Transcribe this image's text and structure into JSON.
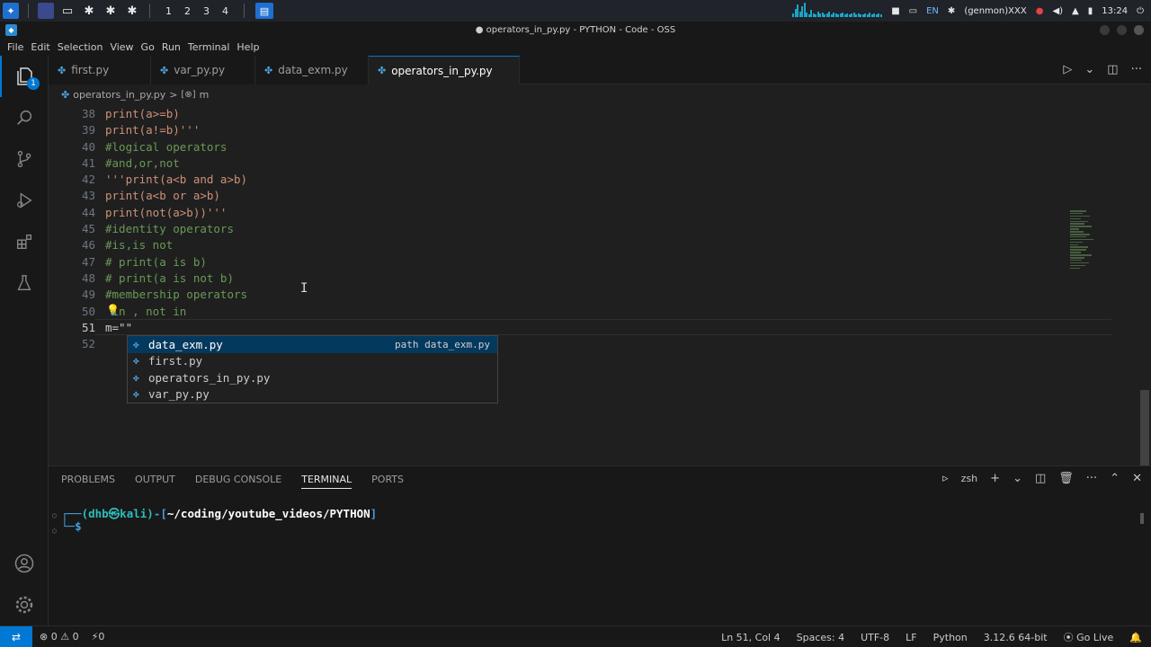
{
  "taskbar": {
    "workspaces": [
      "1",
      "2",
      "3",
      "4"
    ],
    "lang": "EN",
    "user": "(genmon)XXX",
    "time": "13:24"
  },
  "window": {
    "title": "● operators_in_py.py - PYTHON - Code - OSS"
  },
  "menu": [
    "File",
    "Edit",
    "Selection",
    "View",
    "Go",
    "Run",
    "Terminal",
    "Help"
  ],
  "activity": {
    "explorer_badge": "1"
  },
  "tabs": [
    {
      "label": "first.py"
    },
    {
      "label": "var_py.py"
    },
    {
      "label": "data_exm.py"
    },
    {
      "label": "operators_in_py.py"
    }
  ],
  "breadcrumb": {
    "file": "operators_in_py.py",
    "sep": ">",
    "symbol": "m"
  },
  "editor": {
    "lines": [
      {
        "n": "38",
        "text": "print(a>=b)",
        "kind": "str"
      },
      {
        "n": "39",
        "text": "print(a!=b)'''",
        "kind": "str"
      },
      {
        "n": "40",
        "text": "#logical operators",
        "kind": "comment"
      },
      {
        "n": "41",
        "text": "#and,or,not",
        "kind": "comment"
      },
      {
        "n": "42",
        "text": "'''print(a<b and a>b)",
        "kind": "str"
      },
      {
        "n": "43",
        "text": "print(a<b or a>b)",
        "kind": "str"
      },
      {
        "n": "44",
        "text": "print(not(a>b))'''",
        "kind": "str"
      },
      {
        "n": "45",
        "text": "#identity operators",
        "kind": "comment"
      },
      {
        "n": "46",
        "text": "#is,is not",
        "kind": "comment"
      },
      {
        "n": "47",
        "text": "# print(a is b)",
        "kind": "comment"
      },
      {
        "n": "48",
        "text": "# print(a is not b)",
        "kind": "comment"
      },
      {
        "n": "49",
        "text": "#membership operators",
        "kind": "comment"
      },
      {
        "n": "50",
        "text": " in , not in",
        "kind": "comment"
      },
      {
        "n": "51",
        "text": "m=\"\"",
        "kind": "plain"
      },
      {
        "n": "52",
        "text": "",
        "kind": "plain"
      }
    ]
  },
  "suggest": {
    "items": [
      "data_exm.py",
      "first.py",
      "operators_in_py.py",
      "var_py.py"
    ],
    "detail": "path data_exm.py"
  },
  "panel": {
    "tabs": [
      "PROBLEMS",
      "OUTPUT",
      "DEBUG CONSOLE",
      "TERMINAL",
      "PORTS"
    ],
    "shell": "zsh",
    "prompt_user": "(dhb㉿kali)",
    "prompt_path": "~/coding/youtube_videos/PYTHON",
    "prompt_symbol": "$"
  },
  "status": {
    "errors": "0",
    "warnings": "0",
    "ports": "0",
    "position": "Ln 51, Col 4",
    "spaces": "Spaces: 4",
    "encoding": "UTF-8",
    "eol": "LF",
    "language": "Python",
    "interpreter": "3.12.6 64-bit",
    "golive": "Go Live"
  }
}
